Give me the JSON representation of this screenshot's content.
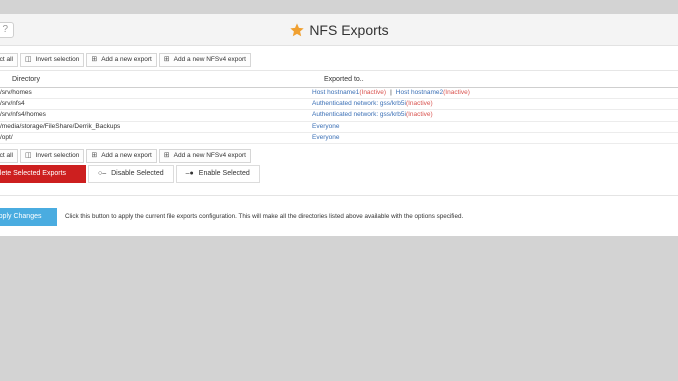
{
  "window": {
    "title": "NFS Exports",
    "help_label": "?"
  },
  "toolbar": {
    "select_all": "ect all",
    "invert_selection": "Invert selection",
    "add_export": "Add a new export",
    "add_nfsv4_export": "Add a new NFSv4 export"
  },
  "table": {
    "headers": {
      "directory": "Directory",
      "exported_to": "Exported to.."
    },
    "rows": [
      {
        "directory": "/srv/homes",
        "host1": "Host hostname1",
        "host1_status": "(Inactive)",
        "separator": "|",
        "host2": "Host hostname2",
        "host2_status": "(Inactive)"
      },
      {
        "directory": "/srv/nfs4",
        "target": "Authenticated network: gss/krb5i",
        "status": "(Inactive)"
      },
      {
        "directory": "/srv/nfs4/homes",
        "target": "Authenticated network: gss/krb5i",
        "status": "(Inactive)"
      },
      {
        "directory": "/media/storage/FileShare/Derrik_Backups",
        "target": "Everyone"
      },
      {
        "directory": "/opt/",
        "target": "Everyone"
      }
    ]
  },
  "actions": {
    "delete_selected": "elete Selected Exports",
    "disable_selected": "Disable Selected",
    "enable_selected": "Enable Selected"
  },
  "apply": {
    "button_label": "Apply Changes",
    "description": "Click this button to apply the current file exports configuration. This will make all the directories listed above available with the options specified."
  },
  "colors": {
    "accent_star": "#f0a030",
    "delete": "#cd1f1f",
    "apply": "#4aace0",
    "link": "#3a6fb5",
    "inactive": "#d9534f"
  }
}
